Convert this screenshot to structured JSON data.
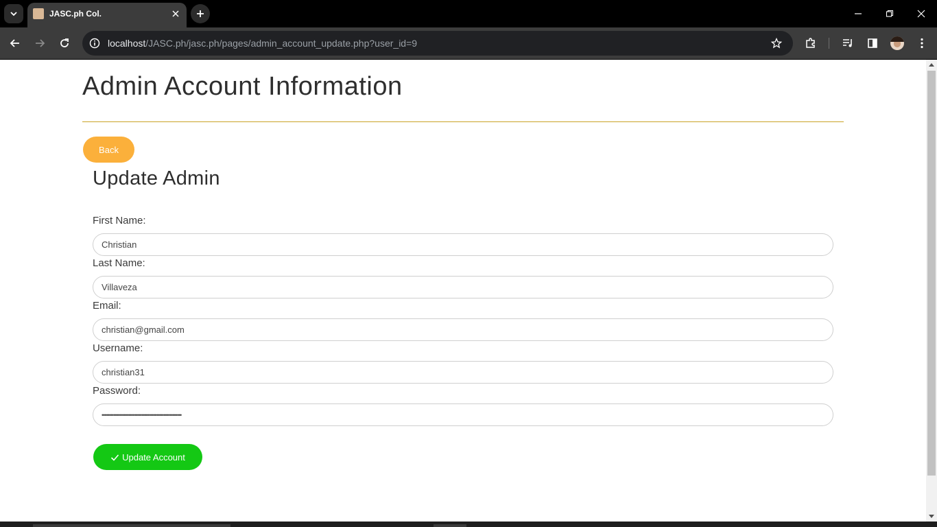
{
  "browser": {
    "tab_title": "JASC.ph Col.",
    "url_host": "localhost",
    "url_path": "/JASC.ph/jasc.ph/pages/admin_account_update.php?user_id=9",
    "icons": [
      "tab-search-icon",
      "close-icon",
      "plus-icon",
      "minimize-icon",
      "restore-icon",
      "close-window-icon",
      "back-icon",
      "forward-icon",
      "reload-icon",
      "info-icon",
      "star-icon",
      "extensions-icon",
      "media-icon",
      "side-panel-icon",
      "avatar",
      "menu-icon"
    ]
  },
  "page": {
    "title": "Admin Account Information",
    "back_label": "Back",
    "section_title": "Update Admin",
    "fields": {
      "first_name": {
        "label": "First Name:",
        "value": "Christian"
      },
      "last_name": {
        "label": "Last Name:",
        "value": "Villaveza"
      },
      "email": {
        "label": "Email:",
        "value": "christian@gmail.com"
      },
      "username": {
        "label": "Username:",
        "value": "christian31"
      },
      "password": {
        "label": "Password:",
        "value": "••••••••••••••••••••••••••••••••••••••••••••••••••••••"
      }
    },
    "submit_label": "Update Account"
  },
  "colors": {
    "back_button": "#fbb03b",
    "update_button": "#14c814",
    "divider": "#c9a227"
  }
}
